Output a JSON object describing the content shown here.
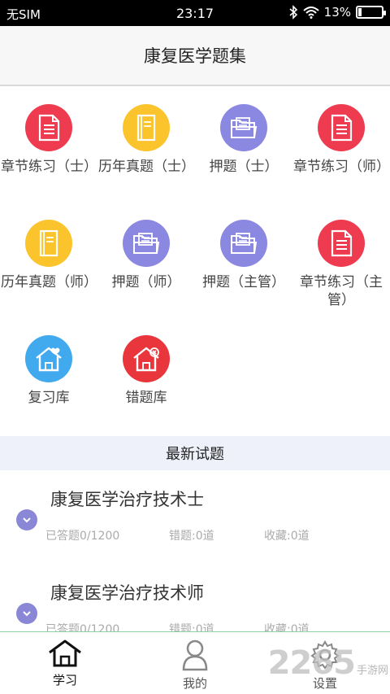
{
  "status_bar": {
    "carrier": "无SIM",
    "time": "23:17",
    "battery": "13%",
    "battery_level": 0.13
  },
  "header": {
    "title": "康复医学题集"
  },
  "grid": [
    {
      "label": "章节练习（士）",
      "icon": "document-icon",
      "color": "#ee3b4f"
    },
    {
      "label": "历年真题（士）",
      "icon": "book-icon",
      "color": "#fbc42c"
    },
    {
      "label": "押题（士）",
      "icon": "folder-icon",
      "color": "#8a88e0"
    },
    {
      "label": "章节练习（师）",
      "icon": "document-icon",
      "color": "#ee3b4f"
    },
    {
      "label": "历年真题（师）",
      "icon": "book-icon",
      "color": "#fbc42c"
    },
    {
      "label": "押题（师）",
      "icon": "folder-icon",
      "color": "#8a88e0"
    },
    {
      "label": "押题（主管）",
      "icon": "folder-icon",
      "color": "#8a88e0"
    },
    {
      "label": "章节练习（主管）",
      "icon": "document-icon",
      "color": "#ee3b4f"
    },
    {
      "label": "复习库",
      "icon": "home-heart-icon",
      "color": "#41a9ee"
    },
    {
      "label": "错题库",
      "icon": "home-error-icon",
      "color": "#e8363c"
    }
  ],
  "latest": {
    "title": "最新试题",
    "items": [
      {
        "name": "康复医学治疗技术士",
        "answered": "已答题0/1200",
        "wrong": "错题:0道",
        "saved": "收藏:0道"
      },
      {
        "name": "康复医学治疗技术师",
        "answered": "已答题0/1200",
        "wrong": "错题:0道",
        "saved": "收藏:0道"
      }
    ]
  },
  "nav": [
    {
      "label": "学习",
      "icon": "home-icon",
      "active": true
    },
    {
      "label": "我的",
      "icon": "person-icon",
      "active": false
    },
    {
      "label": "设置",
      "icon": "gear-icon",
      "active": false
    }
  ],
  "watermark": {
    "brand": "2265",
    "sub": "手游网"
  }
}
